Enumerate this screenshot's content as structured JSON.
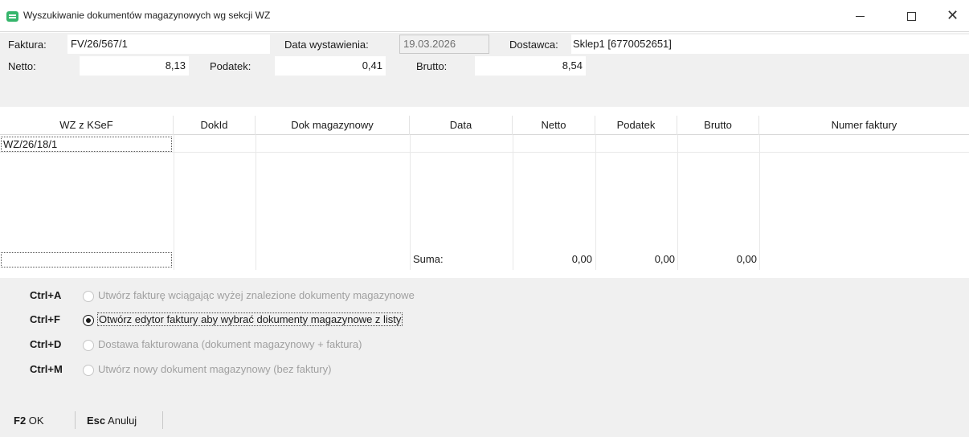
{
  "window": {
    "title": "Wyszukiwanie dokumentów magazynowych wg sekcji WZ"
  },
  "header": {
    "faktura_label": "Faktura:",
    "faktura_value": "FV/26/567/1",
    "data_label": "Data wystawienia:",
    "data_value": "19.03.2026",
    "dostawca_label": "Dostawca:",
    "dostawca_value": "Sklep1 [6770052651]",
    "netto_label": "Netto:",
    "netto_value": "8,13",
    "podatek_label": "Podatek:",
    "podatek_value": "0,41",
    "brutto_label": "Brutto:",
    "brutto_value": "8,54"
  },
  "grid": {
    "columns": [
      "WZ z KSeF",
      "DokId",
      "Dok magazynowy",
      "Data",
      "Netto",
      "Podatek",
      "Brutto",
      "Numer faktury"
    ],
    "rows": [
      {
        "wz": "WZ/26/18/1",
        "dokid": "",
        "dok": "",
        "data": "",
        "netto": "",
        "podatek": "",
        "brutto": "",
        "numer": ""
      }
    ],
    "sum_label": "Suma:",
    "sum_netto": "0,00",
    "sum_podatek": "0,00",
    "sum_brutto": "0,00"
  },
  "options": [
    {
      "key": "Ctrl+A",
      "label": "Utwórz fakturę wciągając wyżej znalezione dokumenty magazynowe",
      "checked": false
    },
    {
      "key": "Ctrl+F",
      "label": "Otwórz edytor faktury aby wybrać dokumenty magazynowe z listy",
      "checked": true
    },
    {
      "key": "Ctrl+D",
      "label": "Dostawa fakturowana (dokument magazynowy + faktura)",
      "checked": false
    },
    {
      "key": "Ctrl+M",
      "label": "Utwórz nowy dokument magazynowy (bez faktury)",
      "checked": false
    }
  ],
  "footer": {
    "ok_key": "F2",
    "ok_label": "OK",
    "cancel_key": "Esc",
    "cancel_label": "Anuluj"
  },
  "colors": {
    "panel_bg": "#f0f0f0",
    "app_icon": "#35b56b"
  }
}
